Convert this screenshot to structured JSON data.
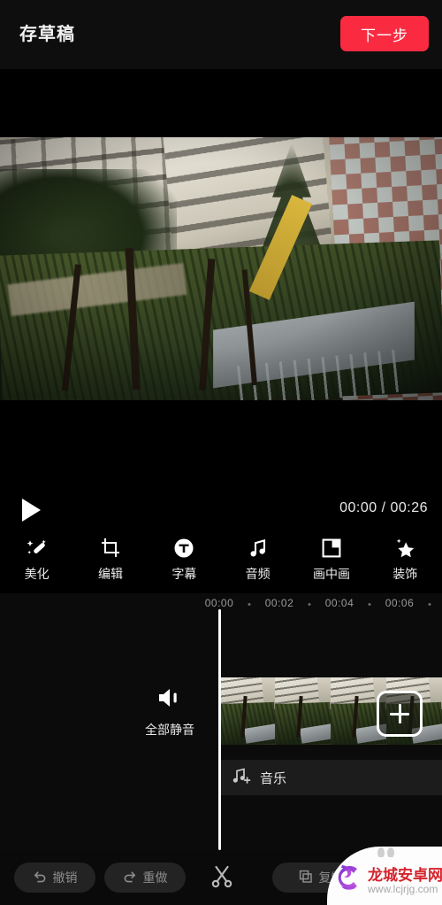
{
  "header": {
    "title": "存草稿",
    "next_label": "下一步",
    "next_color": "#fa2b41"
  },
  "preview": {
    "scene_description": "公寓楼与树木的视频预览"
  },
  "playback": {
    "play_icon": "play-icon",
    "current_time": "00:00",
    "total_time": "00:26",
    "time_display": "00:00 / 00:26"
  },
  "toolbar": {
    "items": [
      {
        "label": "美化",
        "icon": "magic-wand-icon"
      },
      {
        "label": "编辑",
        "icon": "crop-icon"
      },
      {
        "label": "字幕",
        "icon": "text-circle-icon"
      },
      {
        "label": "音频",
        "icon": "music-note-icon"
      },
      {
        "label": "画中画",
        "icon": "picture-in-picture-icon"
      },
      {
        "label": "装饰",
        "icon": "star-sparkle-icon"
      }
    ]
  },
  "timeline": {
    "ruler_ticks": [
      "00:00",
      "00:02",
      "00:04",
      "00:06"
    ],
    "mute": {
      "label": "全部静音",
      "icon": "speaker-mute-icon"
    },
    "add_clip": {
      "label": "+",
      "icon": "plus-icon"
    },
    "music_track": {
      "label": "音乐",
      "icon": "add-music-icon"
    },
    "playhead_position": "00:00"
  },
  "bottom_bar": {
    "undo": {
      "label": "撤销",
      "icon": "undo-icon"
    },
    "redo": {
      "label": "重做",
      "icon": "redo-icon"
    },
    "cut": {
      "icon": "scissors-icon"
    },
    "copy": {
      "label": "复制",
      "icon": "copy-icon"
    }
  },
  "watermark": {
    "title": "龙城安卓网",
    "url": "www.lcjrjg.com",
    "title_color": "#d4232c",
    "logo_color": "#9b3fd4"
  }
}
